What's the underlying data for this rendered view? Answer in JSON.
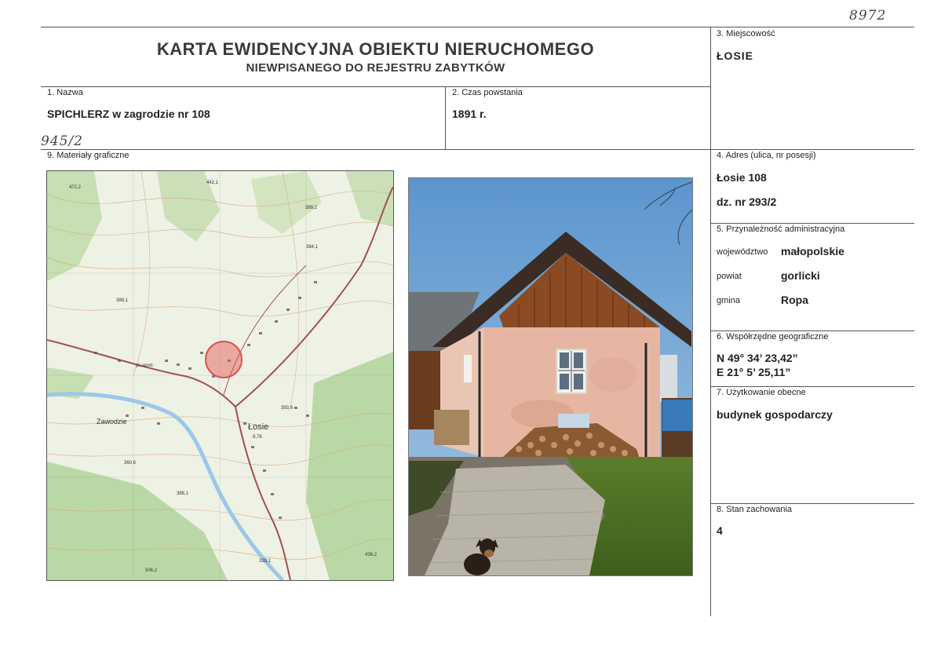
{
  "handwritten": {
    "top_right": "8972",
    "under_name": "945/2"
  },
  "header": {
    "title_line1": "KARTA EWIDENCYJNA OBIEKTU NIERUCHOMEGO",
    "title_line2": "NIEWPISANEGO DO REJESTRU ZABYTKÓW"
  },
  "fields": {
    "nazwa": {
      "label": "1. Nazwa",
      "value": "SPICHLERZ w zagrodzie nr 108"
    },
    "czas": {
      "label": "2. Czas powstania",
      "value": "1891 r."
    },
    "miejscowosc": {
      "label": "3. Miejscowość",
      "value": "ŁOSIE"
    },
    "adres": {
      "label": "4. Adres (ulica, nr posesji)",
      "value1": "Łosie 108",
      "value2": "dz. nr 293/2"
    },
    "przynaleznosc": {
      "label": "5. Przynależność administracyjna",
      "woj_label": "województwo",
      "woj_value": "małopolskie",
      "powiat_label": "powiat",
      "powiat_value": "gorlicki",
      "gmina_label": "gmina",
      "gmina_value": "Ropa"
    },
    "wspolrzedne": {
      "label": "6. Współrzędne geograficzne",
      "line1": "N 49° 34’ 23,42”",
      "line2": "E 21° 5’ 25,11”"
    },
    "uzytkowanie": {
      "label": "7. Użytkowanie obecne",
      "value": "budynek gospodarczy"
    },
    "stan": {
      "label": "8. Stan zachowania",
      "value": "4"
    },
    "materialy": {
      "label": "9. Materiały graficzne"
    }
  },
  "map": {
    "town_label": "Łosie",
    "town_sub": "8,78",
    "village_label": "Zawodzie",
    "labels": [
      "472,2",
      "442,1",
      "399,2",
      "384,1",
      "pl. sport.",
      "388,1",
      "393,6",
      "360,6",
      "388,1",
      "506,2",
      "436,2",
      "339,1"
    ],
    "marker_color": "#e05050"
  },
  "photo": {
    "subject": "granary-building-photo"
  }
}
